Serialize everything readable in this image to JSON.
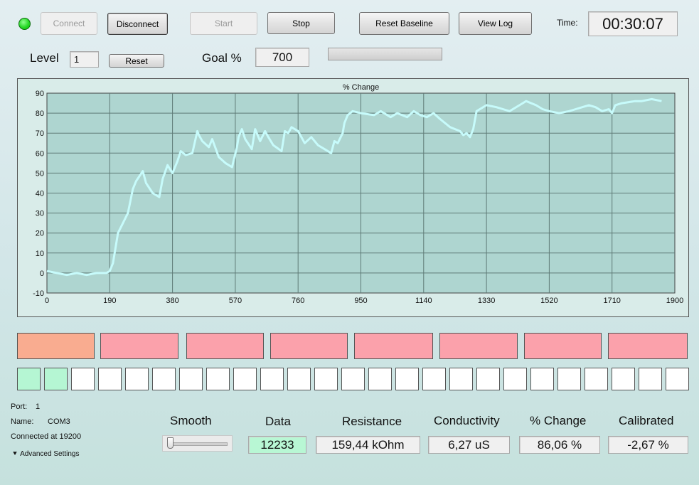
{
  "toolbar": {
    "connect_label": "Connect",
    "disconnect_label": "Disconnect",
    "start_label": "Start",
    "stop_label": "Stop",
    "reset_baseline_label": "Reset Baseline",
    "view_log_label": "View Log",
    "time_label": "Time:",
    "time_value": "00:30:07"
  },
  "status": {
    "led_color": "#1fd51f"
  },
  "level": {
    "label": "Level",
    "value": "1",
    "reset_label": "Reset",
    "goal_label": "Goal %",
    "goal_value": "700",
    "progress": 0
  },
  "chart_data": {
    "type": "line",
    "title": "% Change",
    "xlabel": "",
    "ylabel": "",
    "xlim": [
      0,
      1900
    ],
    "ylim": [
      -10,
      90
    ],
    "x_ticks": [
      0,
      190,
      380,
      570,
      760,
      950,
      1140,
      1330,
      1520,
      1710,
      1900
    ],
    "y_ticks": [
      -10,
      0,
      10,
      20,
      30,
      40,
      50,
      60,
      70,
      80,
      90
    ],
    "grid": true,
    "plot_background": "#aed5d0",
    "line_color": "#c7fbfb",
    "series": [
      {
        "x": [
          0,
          30,
          60,
          90,
          120,
          150,
          180,
          190,
          200,
          215,
          230,
          245,
          260,
          270,
          290,
          300,
          320,
          340,
          350,
          365,
          380,
          395,
          405,
          420,
          440,
          455,
          460,
          470,
          490,
          500,
          520,
          540,
          560,
          575,
          580,
          590,
          600,
          620,
          630,
          645,
          660,
          670,
          685,
          710,
          720,
          730,
          740,
          760,
          780,
          800,
          820,
          840,
          860,
          870,
          880,
          895,
          900,
          910,
          925,
          950,
          990,
          1010,
          1040,
          1060,
          1090,
          1110,
          1130,
          1150,
          1170,
          1190,
          1220,
          1250,
          1260,
          1270,
          1280,
          1290,
          1300,
          1330,
          1360,
          1380,
          1400,
          1430,
          1450,
          1480,
          1500,
          1520,
          1550,
          1580,
          1600,
          1620,
          1640,
          1660,
          1680,
          1700,
          1710,
          1720,
          1740,
          1780,
          1800,
          1830,
          1860
        ],
        "y": [
          1,
          0,
          -1,
          0,
          -1,
          0,
          0,
          1,
          5,
          20,
          25,
          30,
          42,
          46,
          51,
          45,
          40,
          38,
          47,
          54,
          50,
          56,
          61,
          59,
          60,
          71,
          69,
          66,
          63,
          67,
          58,
          55,
          53,
          63,
          68,
          72,
          67,
          62,
          72,
          66,
          71,
          68,
          64,
          61,
          71,
          70,
          73,
          71,
          65,
          68,
          64,
          62,
          60,
          66,
          65,
          70,
          75,
          79,
          81,
          80,
          79,
          81,
          78,
          80,
          78,
          81,
          79,
          78,
          80,
          77,
          73,
          71,
          69,
          70,
          68,
          72,
          81,
          84,
          83,
          82,
          81,
          84,
          86,
          84,
          82,
          81,
          80,
          81,
          82,
          83,
          84,
          83,
          81,
          82,
          80,
          84,
          85,
          86,
          86,
          87,
          86
        ]
      }
    ]
  },
  "indicator_colors": {
    "bars": [
      "#f9ac90",
      "#fba1ab",
      "#fba1ab",
      "#fba1ab",
      "#fba1ab",
      "#fba1ab",
      "#fba1ab",
      "#fba1ab"
    ],
    "cells_active": "#b5f6d3",
    "cells_inactive": "#ffffff",
    "cells_active_count": 2,
    "cells_total": 25
  },
  "connection": {
    "port_label": "Port:",
    "port_value": "1",
    "name_label": "Name:",
    "name_value": "COM3",
    "connected_text": "Connected at 19200",
    "advanced_label": "Advanced Settings"
  },
  "readouts": {
    "smooth_label": "Smooth",
    "smooth_value": 0,
    "data_label": "Data",
    "data_value": "12233",
    "resistance_label": "Resistance",
    "resistance_value": "159,44 kOhm",
    "conductivity_label": "Conductivity",
    "conductivity_value": "6,27 uS",
    "change_label": "% Change",
    "change_value": "86,06 %",
    "calibrated_label": "Calibrated",
    "calibrated_value": "-2,67 %"
  }
}
